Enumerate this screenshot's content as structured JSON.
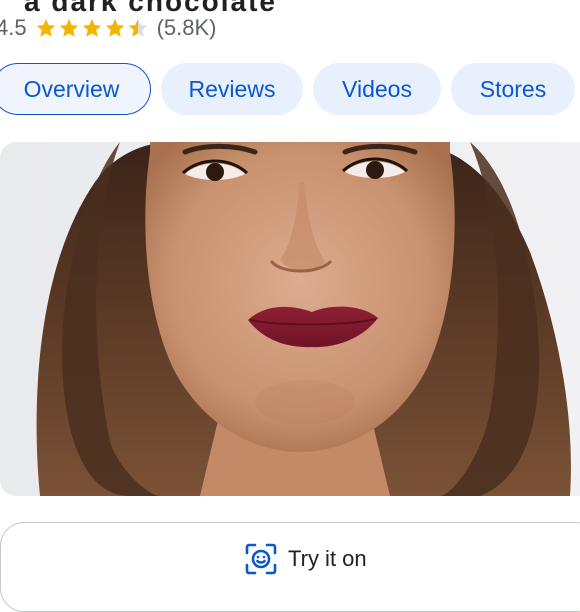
{
  "product": {
    "title_partial": "a dark chocolate"
  },
  "rating": {
    "value": "4.5",
    "stars": 4.5,
    "count": "(5.8K)",
    "star_color": "#f4b400"
  },
  "tabs": [
    {
      "label": "Overview",
      "active": true
    },
    {
      "label": "Reviews",
      "active": false
    },
    {
      "label": "Videos",
      "active": false
    },
    {
      "label": "Stores",
      "active": false
    }
  ],
  "image": {
    "alt_icon": "product-model-photo"
  },
  "try_on": {
    "label": "Try it on",
    "icon": "face-scan-icon",
    "accent": "#0b57d0"
  },
  "colors": {
    "accent": "#0b57d0",
    "chip_bg": "#e8f0fe",
    "star": "#f4b400"
  }
}
